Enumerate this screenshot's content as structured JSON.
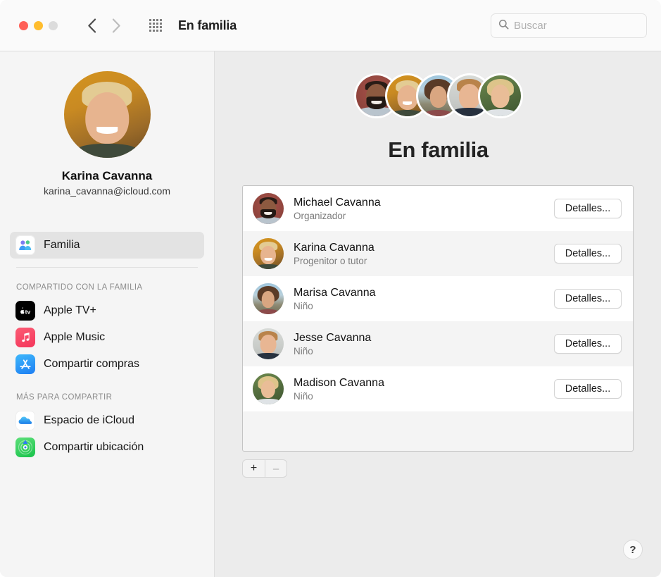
{
  "window": {
    "title": "En familia",
    "traffic_lights": [
      "close",
      "minimize",
      "zoom"
    ]
  },
  "toolbar": {
    "back_icon": "chevron-left-icon",
    "forward_icon": "chevron-right-icon",
    "grid_icon": "grid-view-icon",
    "title": "En familia",
    "search": {
      "icon": "search-icon",
      "placeholder": "Buscar",
      "value": ""
    }
  },
  "sidebar": {
    "profile": {
      "name": "Karina Cavanna",
      "email": "karina_cavanna@icloud.com",
      "avatar": "karina-avatar"
    },
    "primary_items": [
      {
        "label": "Familia",
        "icon": "family-icon",
        "selected": true
      }
    ],
    "sections": [
      {
        "header": "COMPARTIDO CON LA FAMILIA",
        "items": [
          {
            "label": "Apple TV+",
            "icon": "apple-tv-icon"
          },
          {
            "label": "Apple Music",
            "icon": "apple-music-icon"
          },
          {
            "label": "Compartir compras",
            "icon": "app-store-icon"
          }
        ]
      },
      {
        "header": "MÁS PARA COMPARTIR",
        "items": [
          {
            "label": "Espacio de iCloud",
            "icon": "icloud-icon"
          },
          {
            "label": "Compartir ubicación",
            "icon": "find-my-icon"
          }
        ]
      }
    ]
  },
  "main": {
    "title": "En familia",
    "avatar_cluster": [
      "michael-avatar",
      "karina-avatar",
      "marisa-avatar",
      "jesse-avatar",
      "madison-avatar"
    ],
    "members": [
      {
        "name": "Michael Cavanna",
        "role": "Organizador",
        "button": "Detalles...",
        "avatar": "michael-avatar"
      },
      {
        "name": "Karina Cavanna",
        "role": "Progenitor o tutor",
        "button": "Detalles...",
        "avatar": "karina-avatar"
      },
      {
        "name": "Marisa Cavanna",
        "role": "Niño",
        "button": "Detalles...",
        "avatar": "marisa-avatar"
      },
      {
        "name": "Jesse Cavanna",
        "role": "Niño",
        "button": "Detalles...",
        "avatar": "jesse-avatar"
      },
      {
        "name": "Madison Cavanna",
        "role": "Niño",
        "button": "Detalles...",
        "avatar": "madison-avatar"
      }
    ],
    "add_button": "+",
    "remove_button": "–",
    "help_button": "?"
  },
  "colors": {
    "close": "#ff6058",
    "minimize": "#ffbd2e",
    "zoom": "#dcdcdc",
    "sidebar_bg": "#f5f5f5",
    "main_bg": "#ececec",
    "toolbar_bg": "#fafafa",
    "selection": "#e3e3e3",
    "row_alt": "#f4f4f4"
  }
}
